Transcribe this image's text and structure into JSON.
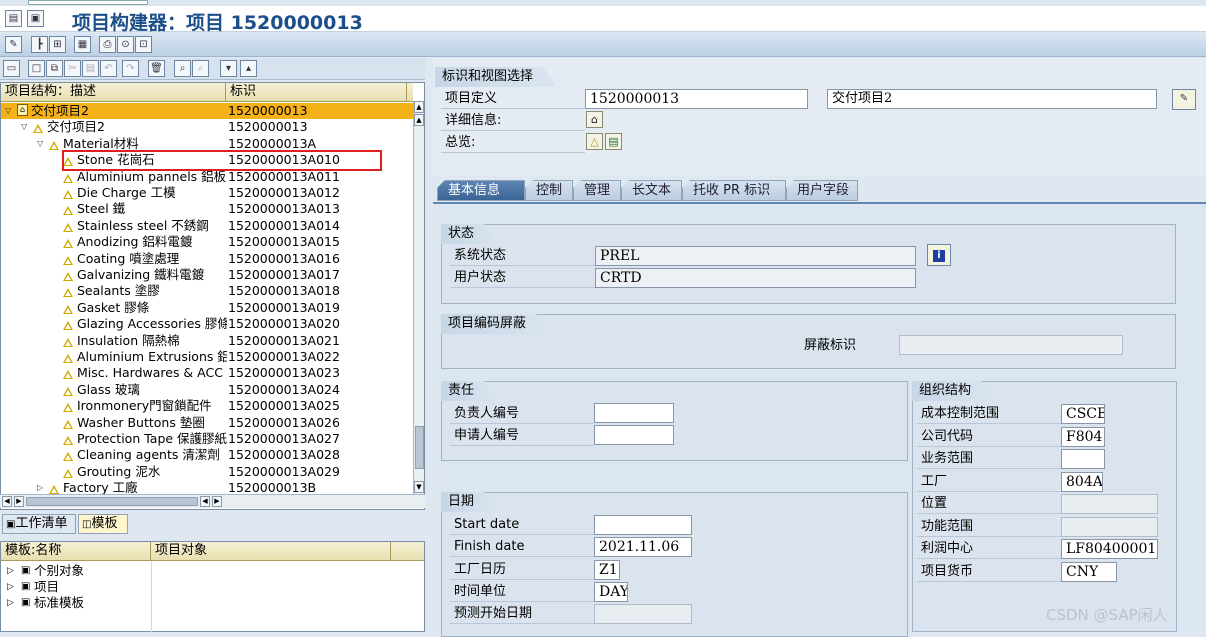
{
  "window": {
    "title": "项目构建器：项目 1520000013"
  },
  "toolbar": {
    "icons": [
      "edit-icon",
      "hierarchy-icon",
      "structure-icon",
      "project-overview-icon",
      "print-icon",
      "settings-icon",
      "close-icon"
    ]
  },
  "left_toolbar": {
    "icons": [
      "open-folder-icon",
      "new-icon",
      "copy-icon",
      "cut-icon",
      "paste-icon",
      "undo-icon",
      "delete-icon",
      "find-icon",
      "find-next-icon",
      "expand-icon",
      "collapse-icon"
    ]
  },
  "tree": {
    "columns": [
      "项目结构：描述",
      "标识"
    ],
    "rows": [
      {
        "desc": "交付项目2",
        "id": "1520000013",
        "level": 0,
        "expanded": true,
        "icon": "project-icon",
        "selected": true
      },
      {
        "desc": "交付项目2",
        "id": "1520000013",
        "level": 1,
        "expanded": true,
        "icon": "wbs-icon"
      },
      {
        "desc": "Material材料",
        "id": "1520000013A",
        "level": 2,
        "expanded": true,
        "icon": "wbs-icon"
      },
      {
        "desc": "Stone 花崗石",
        "id": "1520000013A010",
        "level": 3,
        "icon": "wbs-icon",
        "highlighted": true
      },
      {
        "desc": "Aluminium pannels 鋁板",
        "id": "1520000013A011",
        "level": 3,
        "icon": "wbs-icon"
      },
      {
        "desc": "Die Charge 工模",
        "id": "1520000013A012",
        "level": 3,
        "icon": "wbs-icon"
      },
      {
        "desc": "Steel 鐵",
        "id": "1520000013A013",
        "level": 3,
        "icon": "wbs-icon"
      },
      {
        "desc": "Stainless steel 不銹鋼",
        "id": "1520000013A014",
        "level": 3,
        "icon": "wbs-icon"
      },
      {
        "desc": "Anodizing 鋁料電鍍",
        "id": "1520000013A015",
        "level": 3,
        "icon": "wbs-icon"
      },
      {
        "desc": "Coating 噴塗處理",
        "id": "1520000013A016",
        "level": 3,
        "icon": "wbs-icon"
      },
      {
        "desc": "Galvanizing 鐵料電鍍",
        "id": "1520000013A017",
        "level": 3,
        "icon": "wbs-icon"
      },
      {
        "desc": "Sealants 塗膠",
        "id": "1520000013A018",
        "level": 3,
        "icon": "wbs-icon"
      },
      {
        "desc": "Gasket 膠條",
        "id": "1520000013A019",
        "level": 3,
        "icon": "wbs-icon"
      },
      {
        "desc": "Glazing Accessories 膠條",
        "id": "1520000013A020",
        "level": 3,
        "icon": "wbs-icon"
      },
      {
        "desc": "Insulation 隔熱棉",
        "id": "1520000013A021",
        "level": 3,
        "icon": "wbs-icon"
      },
      {
        "desc": "Aluminium Extrusions 鋁",
        "id": "1520000013A022",
        "level": 3,
        "icon": "wbs-icon"
      },
      {
        "desc": "Misc. Hardwares & ACC 雜",
        "id": "1520000013A023",
        "level": 3,
        "icon": "wbs-icon"
      },
      {
        "desc": "Glass 玻璃",
        "id": "1520000013A024",
        "level": 3,
        "icon": "wbs-icon"
      },
      {
        "desc": "Ironmonery門窗鎖配件",
        "id": "1520000013A025",
        "level": 3,
        "icon": "wbs-icon"
      },
      {
        "desc": "Washer Buttons 墊圈",
        "id": "1520000013A026",
        "level": 3,
        "icon": "wbs-icon"
      },
      {
        "desc": "Protection Tape 保護膠紙",
        "id": "1520000013A027",
        "level": 3,
        "icon": "wbs-icon"
      },
      {
        "desc": "Cleaning agents 清潔劑",
        "id": "1520000013A028",
        "level": 3,
        "icon": "wbs-icon"
      },
      {
        "desc": "Grouting 泥水",
        "id": "1520000013A029",
        "level": 3,
        "icon": "wbs-icon"
      },
      {
        "desc": "Factory 工廠",
        "id": "1520000013B",
        "level": 2,
        "expanded": false,
        "icon": "wbs-icon"
      }
    ]
  },
  "worklist_tabs": [
    "工作清单",
    "模板"
  ],
  "template_table": {
    "columns": [
      "模板:名称",
      "项目对象"
    ],
    "rows": [
      "个别对象",
      "项目",
      "标准模板"
    ]
  },
  "header_group": {
    "title": "标识和视图选择",
    "project_def_label": "项目定义",
    "project_def_value": "1520000013",
    "project_desc_value": "交付项目2",
    "detail_label": "详细信息:",
    "overview_label": "总览:"
  },
  "tabs": [
    "基本信息",
    "控制",
    "管理",
    "长文本",
    "托收 PR 标识",
    "用户字段"
  ],
  "status_group": {
    "title": "状态",
    "system_status_label": "系统状态",
    "system_status_value": "PREL",
    "user_status_label": "用户状态",
    "user_status_value": "CRTD"
  },
  "mask_group": {
    "title": "项目编码屏蔽",
    "mask_label": "屏蔽标识",
    "mask_value": ""
  },
  "resp_group": {
    "title": "责任",
    "resp_person_label": "负责人编号",
    "applicant_label": "申请人编号"
  },
  "org_group": {
    "title": "组织结构",
    "items": [
      {
        "label": "成本控制范围",
        "value": "CSCE"
      },
      {
        "label": "公司代码",
        "value": "F804"
      },
      {
        "label": "业务范围",
        "value": ""
      },
      {
        "label": "工厂",
        "value": "804A"
      },
      {
        "label": "位置",
        "value": ""
      },
      {
        "label": "功能范围",
        "value": ""
      },
      {
        "label": "利润中心",
        "value": "LF80400001"
      },
      {
        "label": "项目货币",
        "value": "CNY"
      }
    ]
  },
  "date_group": {
    "title": "日期",
    "items": [
      {
        "label": "Start date",
        "value": ""
      },
      {
        "label": "Finish date",
        "value": "2021.11.06"
      },
      {
        "label": "工厂日历",
        "value": "Z1"
      },
      {
        "label": "时间单位",
        "value": "DAY"
      },
      {
        "label": "预测开始日期",
        "value": ""
      }
    ]
  },
  "watermark": "CSDN @SAP闲人"
}
